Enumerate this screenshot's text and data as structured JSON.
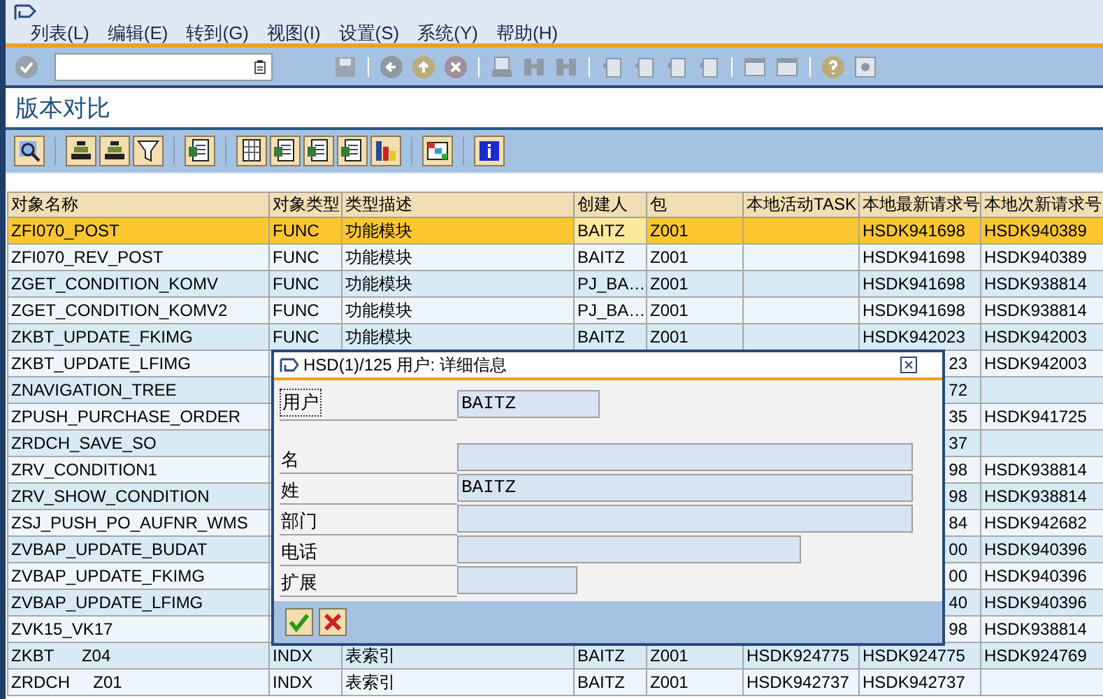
{
  "menu": [
    "列表(L)",
    "编辑(E)",
    "转到(G)",
    "视图(I)",
    "设置(S)",
    "系统(Y)",
    "帮助(H)"
  ],
  "screen_title": "版本对比",
  "table": {
    "columns": [
      "对象名称",
      "对象类型",
      "类型描述",
      "创建人",
      "包",
      "本地活动TASK",
      "本地最新请求号",
      "本地次新请求号"
    ],
    "rows": [
      {
        "selected": true,
        "name": "ZFI070_POST",
        "type": "FUNC",
        "desc": "功能模块",
        "creator": "BAITZ",
        "package": "Z001",
        "latest": "HSDK941698",
        "next": "HSDK940389"
      },
      {
        "selected": false,
        "name": "ZFI070_REV_POST",
        "type": "FUNC",
        "desc": "功能模块",
        "creator": "BAITZ",
        "package": "Z001",
        "latest": "HSDK941698",
        "next": "HSDK940389"
      },
      {
        "selected": false,
        "name": "ZGET_CONDITION_KOMV",
        "type": "FUNC",
        "desc": "功能模块",
        "creator": "PJ_BA…",
        "package": "Z001",
        "latest": "HSDK941698",
        "next": "HSDK938814"
      },
      {
        "selected": false,
        "name": "ZGET_CONDITION_KOMV2",
        "type": "FUNC",
        "desc": "功能模块",
        "creator": "PJ_BA…",
        "package": "Z001",
        "latest": "HSDK941698",
        "next": "HSDK938814"
      },
      {
        "selected": false,
        "name": "ZKBT_UPDATE_FKIMG",
        "type": "FUNC",
        "desc": "功能模块",
        "creator": "BAITZ",
        "package": "Z001",
        "latest": "HSDK942023",
        "next": "HSDK942003"
      },
      {
        "selected": false,
        "name": "ZKBT_UPDATE_LFIMG",
        "latest_tail": "23",
        "next": "HSDK942003"
      },
      {
        "selected": false,
        "name": "ZNAVIGATION_TREE",
        "latest_tail": "72"
      },
      {
        "selected": false,
        "name": "ZPUSH_PURCHASE_ORDER",
        "latest_tail": "35",
        "next": "HSDK941725"
      },
      {
        "selected": false,
        "name": "ZRDCH_SAVE_SO",
        "latest_tail": "37"
      },
      {
        "selected": false,
        "name": "ZRV_CONDITION1",
        "latest_tail": "98",
        "next": "HSDK938814"
      },
      {
        "selected": false,
        "name": "ZRV_SHOW_CONDITION",
        "latest_tail": "98",
        "next": "HSDK938814"
      },
      {
        "selected": false,
        "name": "ZSJ_PUSH_PO_AUFNR_WMS",
        "latest_tail": "84",
        "next": "HSDK942682"
      },
      {
        "selected": false,
        "name": "ZVBAP_UPDATE_BUDAT",
        "latest_tail": "00",
        "next": "HSDK940396"
      },
      {
        "selected": false,
        "name": "ZVBAP_UPDATE_FKIMG",
        "latest_tail": "00",
        "next": "HSDK940396"
      },
      {
        "selected": false,
        "name": "ZVBAP_UPDATE_LFIMG",
        "latest_tail": "40",
        "next": "HSDK940396"
      },
      {
        "selected": false,
        "name": "ZVK15_VK17",
        "latest_tail": "98",
        "next": "HSDK938814"
      },
      {
        "selected": false,
        "name": "ZKBT      Z04",
        "type": "INDX",
        "desc": "表索引",
        "creator": "BAITZ",
        "package": "Z001",
        "task": "HSDK924775",
        "latest": "HSDK924775",
        "next": "HSDK924769"
      },
      {
        "selected": false,
        "name": "ZRDCH     Z01",
        "type": "INDX",
        "desc": "表索引",
        "creator": "BAITZ",
        "package": "Z001",
        "task": "HSDK942737",
        "latest": "HSDK942737"
      }
    ]
  },
  "dialog": {
    "title": "HSD(1)/125 用户: 详细信息",
    "user": {
      "label": "用户",
      "value": "BAITZ",
      "focused": true
    },
    "fields": [
      {
        "label": "名",
        "kind": "long"
      },
      {
        "label": "姓",
        "value": "BAITZ",
        "kind": "long"
      },
      {
        "label": "部门",
        "kind": "long"
      },
      {
        "label": "电话",
        "kind": "medium"
      },
      {
        "label": "扩展",
        "kind": "short"
      }
    ]
  }
}
